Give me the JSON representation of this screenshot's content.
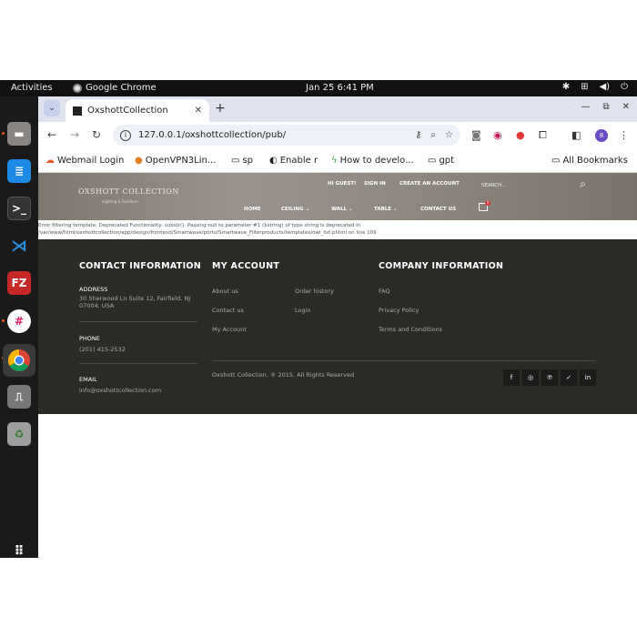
{
  "topbar": {
    "activities": "Activities",
    "app_name": "Google Chrome",
    "clock": "Jan 25  6:41 PM"
  },
  "dock": {
    "items": [
      "files",
      "writer",
      "terminal",
      "vscode",
      "filezilla",
      "slack",
      "chrome",
      "usb",
      "trash",
      "apps-grid"
    ]
  },
  "browser": {
    "tab_title": "OxshottCollection",
    "url": "127.0.0.1/oxshottcollection/pub/",
    "profile_initial": "8",
    "bookmarks": [
      "Webmail Login",
      "OpenVPN3Lin...",
      "sp",
      "Enable r",
      "How to develo...",
      "gpt"
    ],
    "all_bookmarks": "All Bookmarks"
  },
  "site": {
    "logo": "OXSHOTT COLLECTION",
    "tagline": "Lighting & Furniture",
    "top_links": [
      "HI GUEST!",
      "SIGN IN",
      "CREATE AN ACCOUNT"
    ],
    "menu": [
      "HOME",
      "CEILING",
      "WALL",
      "TABLE",
      "CONTACT US"
    ],
    "search_placeholder": "SEARCH...",
    "cart_count": "0",
    "error": "Error filtering template: Deprecated Functionality: substr(): Passing null to parameter #1 ($string) of type string is deprecated in /var/www/html/oxshottcollection/app/design/frontend/Smartwave/porto/Smartwave_Filterproducts/templates/owl_list.phtml on line 109"
  },
  "footer": {
    "contact_heading": "CONTACT INFORMATION",
    "address_label": "ADDRESS",
    "address": "30 Sherwood Ln Suite 12, Fairfield, NJ 07004, USA",
    "phone_label": "PHONE",
    "phone": "(201) 415-2532",
    "email_label": "EMAIL",
    "email": "info@oxshottcollection.com",
    "account_heading": "MY ACCOUNT",
    "account_col1": [
      "About us",
      "Contact us",
      "My Account"
    ],
    "account_col2": [
      "Order history",
      "Login"
    ],
    "company_heading": "COMPANY INFORMATION",
    "company_links": [
      "FAQ",
      "Privacy Policy",
      "Terms and Conditions"
    ],
    "copyright": "Oxshott Collection. ® 2015. All Rights Reserved",
    "social": [
      "facebook-icon",
      "instagram-icon",
      "pinterest-icon",
      "twitter-icon",
      "linkedin-icon"
    ]
  }
}
